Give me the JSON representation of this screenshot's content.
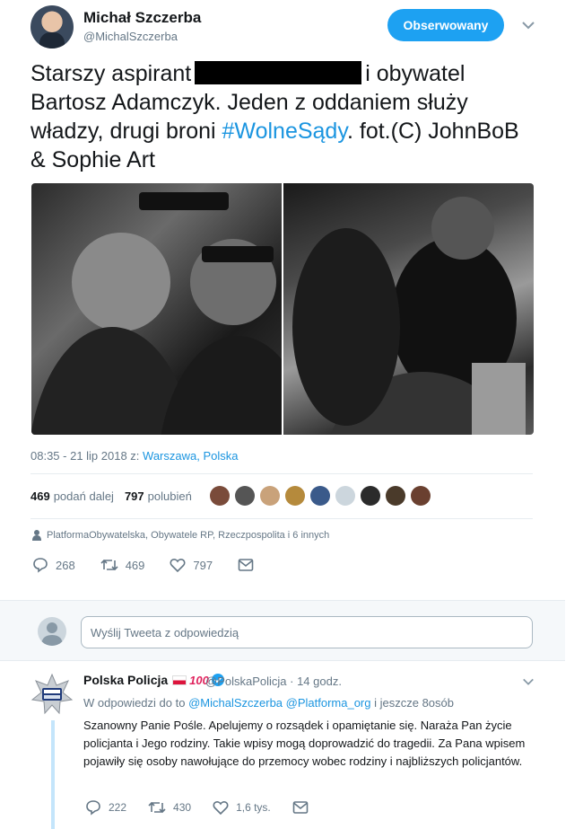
{
  "author": {
    "name": "Michał Szczerba",
    "handle": "@MichalSzczerba",
    "follow_label": "Obserwowany"
  },
  "tweet": {
    "text_before": "Starszy aspirant",
    "text_after": "i obywatel Bartosz Adamczyk. Jeden z oddaniem służy władzy, drugi broni ",
    "hashtag": "#WolneSądy",
    "text_end": ". fot.(C) JohnBoB & Sophie Art",
    "timestamp": "08:35 - 21 lip 2018 z: ",
    "location": "Warszawa, Polska"
  },
  "stats": {
    "retweets_count": "469",
    "retweets_label": "podań dalej",
    "likes_count": "797",
    "likes_label": "polubień"
  },
  "context_line": "PlatformaObywatelska, Obywatele RP, Rzeczpospolita i 6 innych",
  "actions": {
    "replies": "268",
    "retweets": "469",
    "likes": "797"
  },
  "reply_box": {
    "placeholder": "Wyślij Tweeta z odpowiedzią"
  },
  "reply": {
    "name": "Polska Policja",
    "hundred": "100",
    "handle_time": "@PolskaPolicja · 14 godz.",
    "context_prefix": "W odpowiedzi do to ",
    "mentions": "@MichalSzczerba @Platforma_org",
    "context_suffix": " i jeszcze 8osób",
    "text": "Szanowny Panie Pośle. Apelujemy o rozsądek i opamiętanie się. Naraża Pan życie policjanta i Jego rodziny. Takie wpisy mogą doprowadzić do tragedii. Za Pana wpisem pojawiły się osoby nawołujące do przemocy wobec rodziny i najbliższych policjantów.",
    "replies": "222",
    "retweets": "430",
    "likes": "1,6 tys."
  },
  "colors": {
    "accent": "#1da1f2",
    "link": "#1b95e0",
    "muted": "#657786"
  }
}
